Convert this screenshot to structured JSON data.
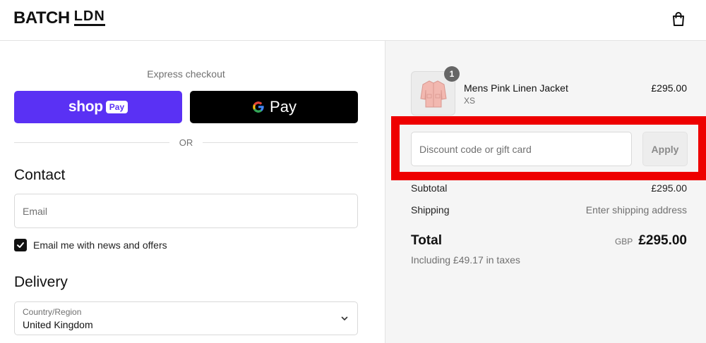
{
  "header": {
    "logo_main": "BATCH",
    "logo_secondary": "LDN",
    "cart_icon": "shopping-bag-icon"
  },
  "checkout": {
    "express_label": "Express checkout",
    "shop_pay": {
      "word": "shop",
      "badge": "Pay",
      "color": "#5a31f4"
    },
    "google_pay": {
      "word": "Pay",
      "icon": "google-g-icon"
    },
    "or_label": "OR",
    "contact": {
      "title": "Contact",
      "email_placeholder": "Email",
      "newsletter_label": "Email me with news and offers",
      "newsletter_checked": true
    },
    "delivery": {
      "title": "Delivery",
      "country_label": "Country/Region",
      "country_value": "United Kingdom"
    }
  },
  "summary": {
    "item": {
      "name": "Mens Pink Linen Jacket",
      "variant": "XS",
      "price": "£295.00",
      "quantity": "1",
      "image_icon": "pink-jacket-thumbnail"
    },
    "discount": {
      "placeholder": "Discount code or gift card",
      "apply_label": "Apply"
    },
    "subtotal_label": "Subtotal",
    "subtotal_value": "£295.00",
    "shipping_label": "Shipping",
    "shipping_value": "Enter shipping address",
    "total_label": "Total",
    "currency": "GBP",
    "total_value": "£295.00",
    "taxes_note": "Including £49.17 in taxes"
  },
  "colors": {
    "highlight": "#ee0000",
    "shop_pay": "#5a31f4",
    "summary_bg": "#f5f5f5"
  }
}
